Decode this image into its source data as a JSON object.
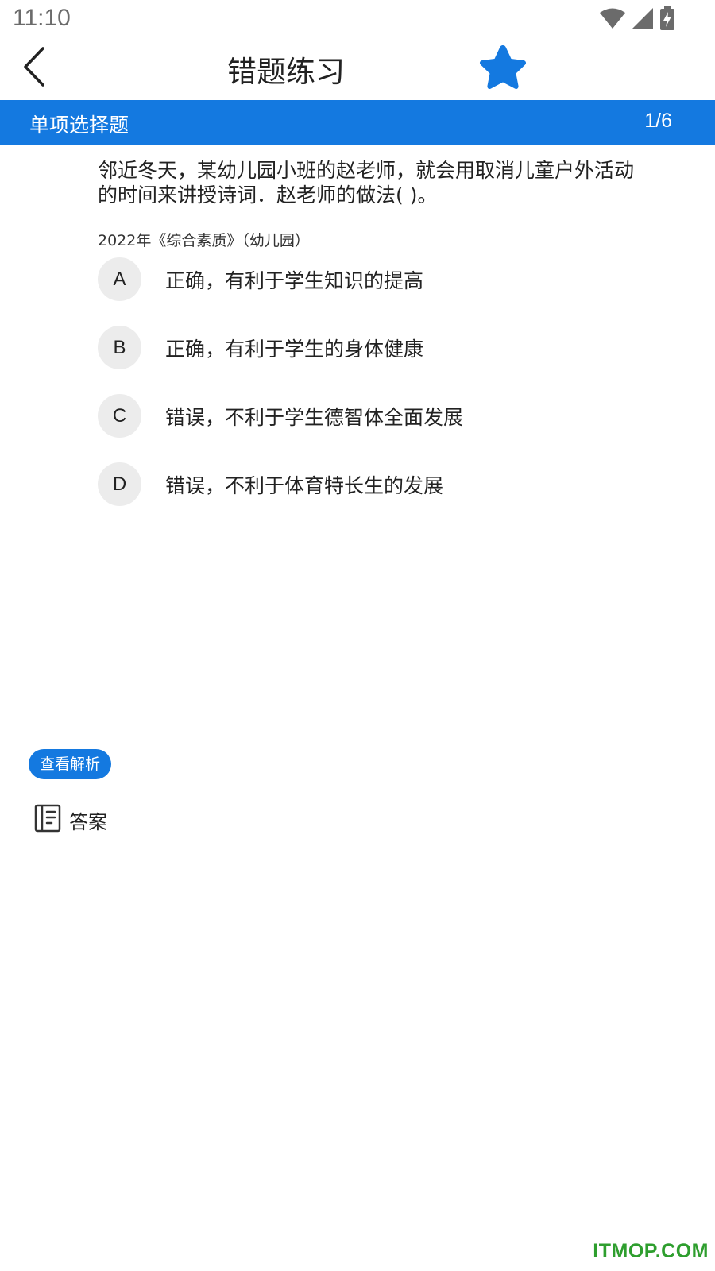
{
  "status_bar": {
    "time": "11:10",
    "icons": [
      "wifi-icon",
      "cellular-signal-icon",
      "battery-charging-icon"
    ]
  },
  "header": {
    "title": "错题练习",
    "back_icon": "chevron-left-icon",
    "favorite_icon": "star-icon",
    "favorited": true
  },
  "section": {
    "title": "单项选择题",
    "progress": "1/6"
  },
  "question": {
    "text": "邻近冬天，某幼儿园小班的赵老师，就会用取消儿童户外活动的时间来讲授诗词．赵老师的做法( )。",
    "source": "2022年《综合素质》（幼儿园）"
  },
  "options": [
    {
      "letter": "A",
      "text": "正确，有利于学生知识的提高"
    },
    {
      "letter": "B",
      "text": "正确，有利于学生的身体健康"
    },
    {
      "letter": "C",
      "text": "错误，不利于学生德智体全面发展"
    },
    {
      "letter": "D",
      "text": "错误，不利于体育特长生的发展"
    }
  ],
  "analysis": {
    "button_label": "查看解析",
    "answer_label": "答案",
    "answer_icon": "notebook-icon"
  },
  "watermark": "ITMOP.COM",
  "colors": {
    "accent": "#1479e0",
    "option_bg": "#ececec",
    "watermark": "#2e9e2e"
  }
}
